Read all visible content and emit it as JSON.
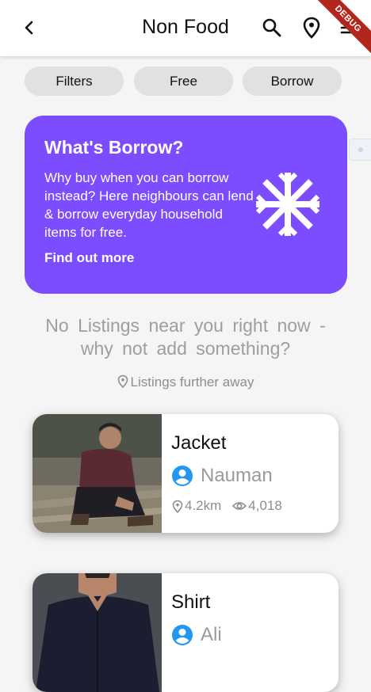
{
  "appbar": {
    "title": "Non Food",
    "debug_label": "DEBUG"
  },
  "filters": {
    "chips": [
      {
        "label": "Filters"
      },
      {
        "label": "Free"
      },
      {
        "label": "Borrow"
      }
    ]
  },
  "promo": {
    "title": "What's Borrow?",
    "body": "Why buy when you can borrow instead? Here neighbours can lend & borrow everyday household items for free.",
    "link": "Find out more",
    "accent": "#7b4dff",
    "icon": "snowflake-icon"
  },
  "empty_message": "No Listings near you right now - why not add something?",
  "further_link": "Listings further away",
  "listings": [
    {
      "title": "Jacket",
      "owner": "Nauman",
      "distance": "4.2km",
      "views": "4,018"
    },
    {
      "title": "Shirt",
      "owner": "Ali",
      "distance": "",
      "views": ""
    }
  ],
  "colors": {
    "avatar_blue": "#2196f3",
    "debug_red": "#b3261e"
  }
}
